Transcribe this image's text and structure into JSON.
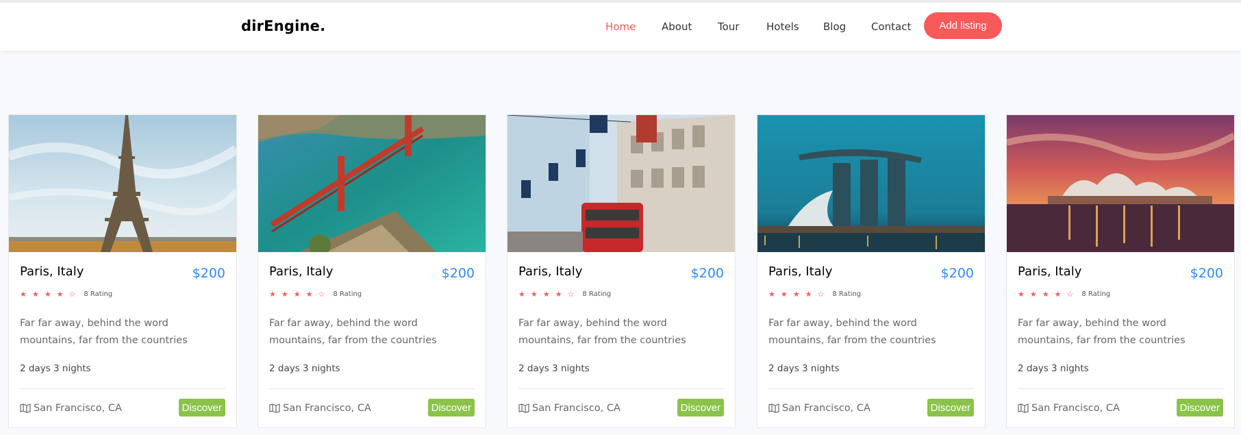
{
  "navbar": {
    "brand": "dirEngine.",
    "items": [
      {
        "label": "Home",
        "active": true
      },
      {
        "label": "About"
      },
      {
        "label": "Tour"
      },
      {
        "label": "Hotels"
      },
      {
        "label": "Blog"
      },
      {
        "label": "Contact"
      }
    ],
    "cta": "Add listing"
  },
  "cards": [
    {
      "title": "Paris, Italy",
      "price": "$200",
      "rating": "8 Rating",
      "description": "Far far away, behind the word mountains, far from the countries",
      "duration": "2 days 3 nights",
      "location": "San Francisco, CA",
      "button": "Discover",
      "image": "eiffel-tower"
    },
    {
      "title": "Paris, Italy",
      "price": "$200",
      "rating": "8 Rating",
      "description": "Far far away, behind the word mountains, far from the countries",
      "duration": "2 days 3 nights",
      "location": "San Francisco, CA",
      "button": "Discover",
      "image": "golden-gate-bridge"
    },
    {
      "title": "Paris, Italy",
      "price": "$200",
      "rating": "8 Rating",
      "description": "Far far away, behind the word mountains, far from the countries",
      "duration": "2 days 3 nights",
      "location": "San Francisco, CA",
      "button": "Discover",
      "image": "london-street"
    },
    {
      "title": "Paris, Italy",
      "price": "$200",
      "rating": "8 Rating",
      "description": "Far far away, behind the word mountains, far from the countries",
      "duration": "2 days 3 nights",
      "location": "San Francisco, CA",
      "button": "Discover",
      "image": "marina-bay-sands"
    },
    {
      "title": "Paris, Italy",
      "price": "$200",
      "rating": "8 Rating",
      "description": "Far far away, behind the word mountains, far from the countries",
      "duration": "2 days 3 nights",
      "location": "San Francisco, CA",
      "button": "Discover",
      "image": "sydney-opera-house"
    }
  ],
  "colors": {
    "accent": "#f85959",
    "price": "#2f89fc",
    "button": "#8bc34a"
  },
  "icons": {
    "star_filled": "★",
    "star_empty": "☆",
    "location": "map-icon"
  }
}
